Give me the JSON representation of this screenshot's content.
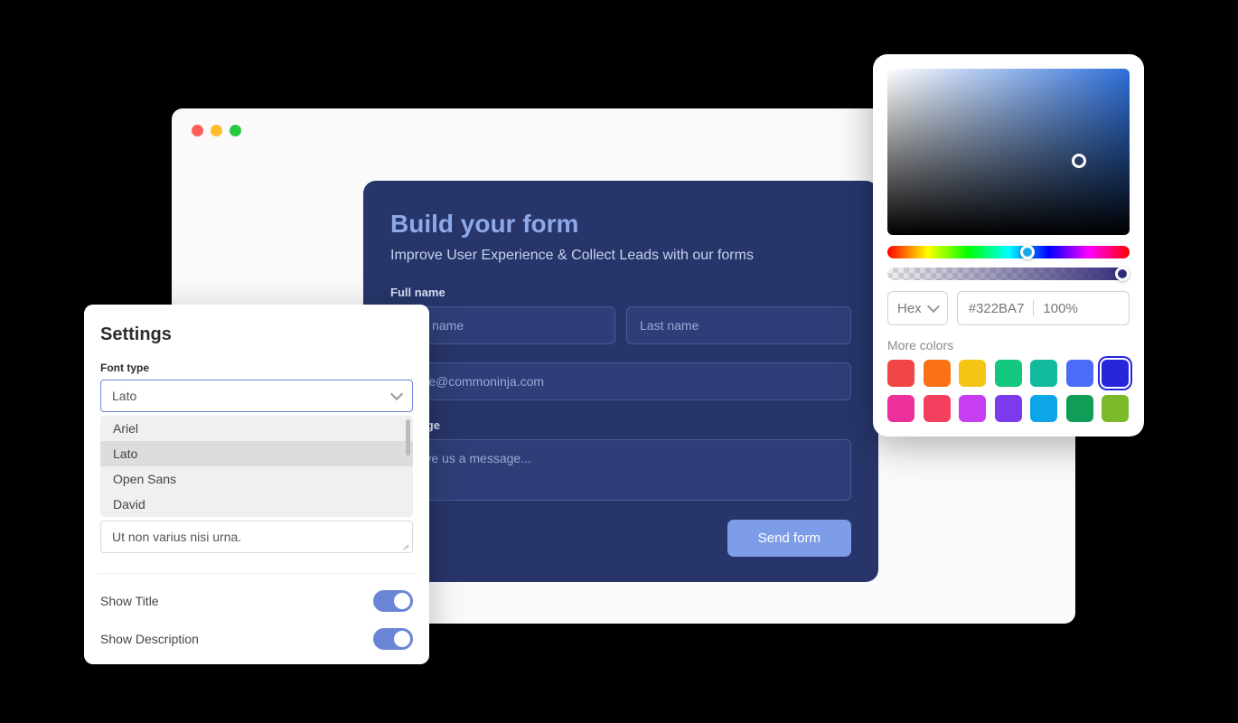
{
  "browser": {
    "dots": [
      "red",
      "yellow",
      "green"
    ]
  },
  "form": {
    "title": "Build your form",
    "subtitle": "Improve User Experience & Collect Leads with our forms",
    "fullname_label": "Full name",
    "firstname_placeholder": "First name",
    "lastname_placeholder": "Last name",
    "email_placeholder": "name@commoninja.com",
    "message_label": "Message",
    "message_placeholder": "Leave us a message...",
    "submit_label": "Send form"
  },
  "settings": {
    "title": "Settings",
    "font_type_label": "Font type",
    "font_selected": "Lato",
    "font_options": [
      "Ariel",
      "Lato",
      "Open Sans",
      "David"
    ],
    "note_text": "Ut non varius nisi urna.",
    "toggles": [
      {
        "label": "Show Title",
        "on": true
      },
      {
        "label": "Show Description",
        "on": true
      }
    ]
  },
  "colorpicker": {
    "format_label": "Hex",
    "hex_value": "#322BA7",
    "alpha_value": "100%",
    "more_label": "More colors",
    "swatches": [
      "#f04646",
      "#f97316",
      "#f5c516",
      "#13c87e",
      "#12ba9d",
      "#4a6cf7",
      "#2626dd",
      "#ec2f9b",
      "#f43f5e",
      "#c73df1",
      "#7c3aed",
      "#0ea5e9",
      "#0f9d58",
      "#7bbb2a"
    ],
    "selected_swatch": 6
  }
}
